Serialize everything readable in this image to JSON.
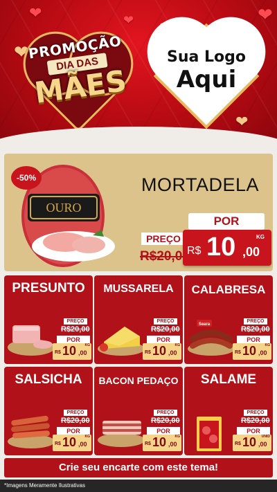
{
  "header": {
    "promo_line1": "PROMOÇÃO",
    "promo_line2": "DIA DAS",
    "promo_line3": "MÃES",
    "logo_line1": "Sua Logo",
    "logo_line2": "Aqui"
  },
  "featured": {
    "discount": "-50%",
    "title": "MORTADELA",
    "preco_label": "PREÇO",
    "old_price": "R$20,00",
    "por_label": "POR",
    "currency": "R$",
    "price_int": "10",
    "price_dec": ",00",
    "unit": "KG",
    "image_icon": "mortadela-image"
  },
  "products": [
    {
      "title": "PRESUNTO",
      "preco_label": "PREÇO",
      "old_price": "R$20,00",
      "por_label": "POR",
      "currency": "R$",
      "price_int": "10",
      "price_dec": ",00",
      "unit": "KG",
      "image_icon": "presunto-image"
    },
    {
      "title": "MUSSARELA",
      "preco_label": "PREÇO",
      "old_price": "R$20,00",
      "por_label": "POR",
      "currency": "R$",
      "price_int": "10",
      "price_dec": ",00",
      "unit": "KG",
      "image_icon": "mussarela-image"
    },
    {
      "title": "CALABRESA",
      "preco_label": "PREÇO",
      "old_price": "R$20,00",
      "por_label": "POR",
      "currency": "R$",
      "price_int": "10",
      "price_dec": ",00",
      "unit": "KG",
      "image_icon": "calabresa-image"
    },
    {
      "title": "SALSICHA",
      "preco_label": "PREÇO",
      "old_price": "R$20,00",
      "por_label": "POR",
      "currency": "R$",
      "price_int": "10",
      "price_dec": ",00",
      "unit": "KG",
      "image_icon": "salsicha-image"
    },
    {
      "title": "BACON PEDAÇO",
      "preco_label": "PREÇO",
      "old_price": "R$20,00",
      "por_label": "POR",
      "currency": "R$",
      "price_int": "10",
      "price_dec": ",00",
      "unit": "KG",
      "image_icon": "bacon-image"
    },
    {
      "title": "SALAME",
      "preco_label": "PREÇO",
      "old_price": "R$20,00",
      "por_label": "POR",
      "currency": "R$",
      "price_int": "10",
      "price_dec": ",00",
      "unit": "UNID",
      "image_icon": "salame-image"
    }
  ],
  "cta": "Crie seu encarte com este tema!",
  "footer": "*Imagens Meramente Ilustrativas",
  "colors": {
    "brand_red": "#b1121a",
    "gold": "#f5d489",
    "featured_bg": "#dcc38b"
  }
}
